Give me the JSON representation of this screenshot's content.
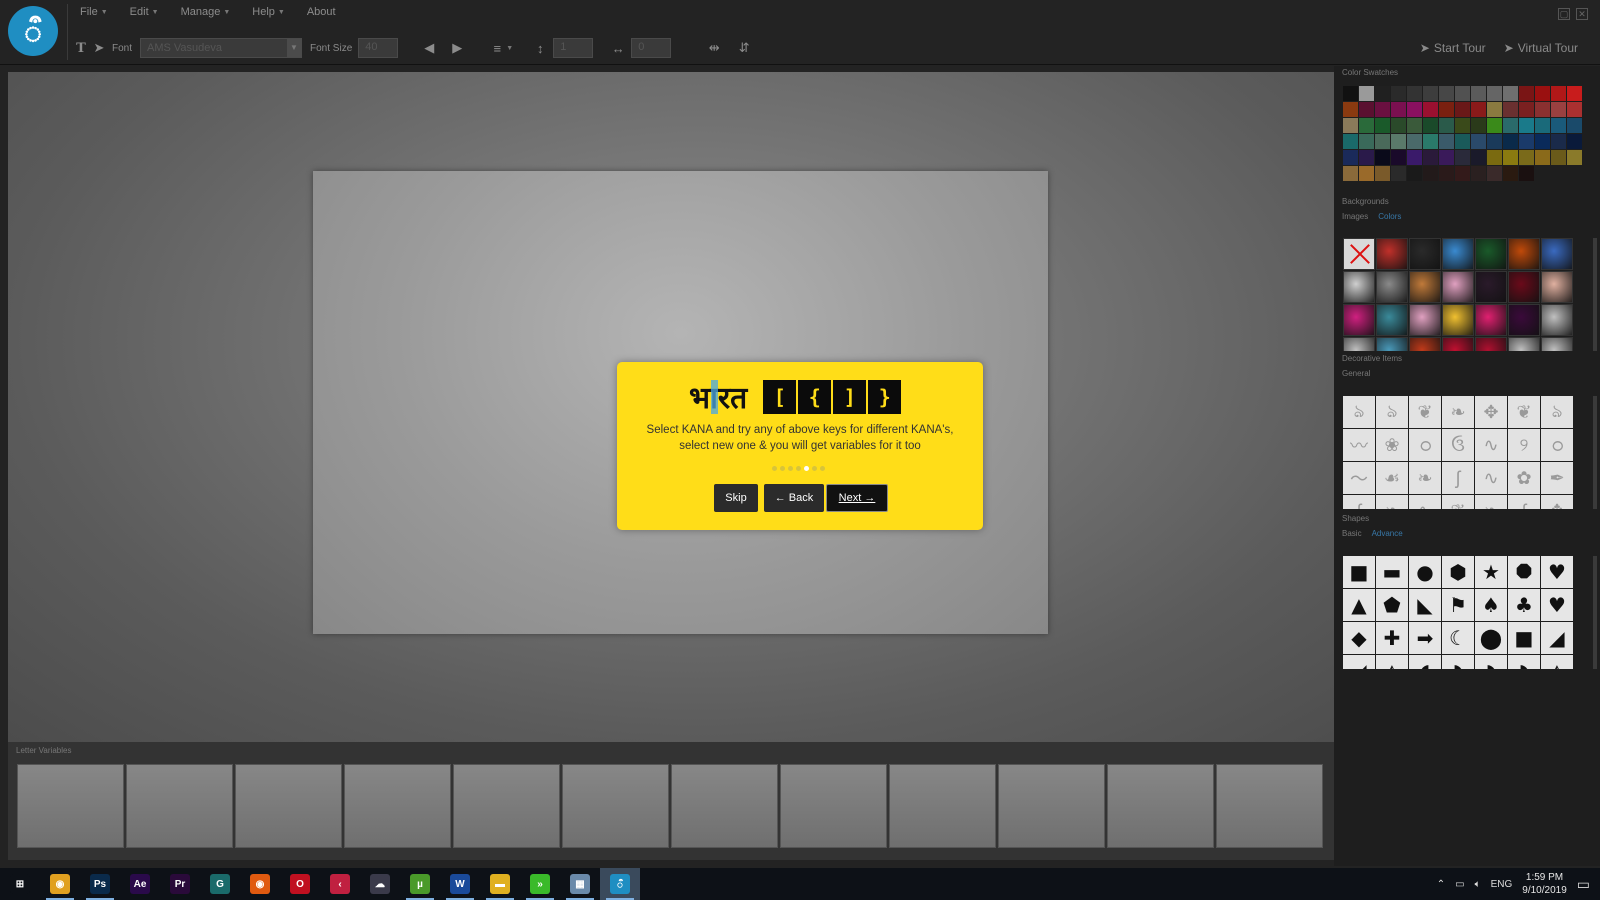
{
  "app": {
    "logo_glyph": "ऀ",
    "menu": [
      {
        "label": "File",
        "has_caret": true
      },
      {
        "label": "Edit",
        "has_caret": true
      },
      {
        "label": "Manage",
        "has_caret": true
      },
      {
        "label": "Help",
        "has_caret": true
      },
      {
        "label": "About",
        "has_caret": false
      }
    ]
  },
  "toolbar": {
    "font_label": "Font",
    "font_value": "AMS Vasudeva",
    "font_size_label": "Font Size",
    "font_size_value": "40",
    "line_height_value": "1",
    "letter_spacing_value": "0",
    "start_tour_label": "Start Tour",
    "virtual_tour_label": "Virtual Tour"
  },
  "tour": {
    "word": "भारत",
    "keys": [
      "[",
      "{",
      "]",
      "}"
    ],
    "text_line1": "Select KANA and try any of above keys for different KANA's,",
    "text_line2": "select new one & you will get variables for it too",
    "steps_total": 7,
    "current_step": 5,
    "skip_label": "Skip",
    "back_label": "← Back",
    "next_label": "Next →"
  },
  "letter_variables": {
    "title": "Letter Variables",
    "cell_count": 12
  },
  "right_panel": {
    "color_swatches_title": "Color Swatches",
    "swatches": [
      "#111111",
      "#9a9a9a",
      "#202020",
      "#2a2a2a",
      "#333333",
      "#3d3d3d",
      "#474747",
      "#515151",
      "#5b5b5b",
      "#656565",
      "#6f6f6f",
      "#7a1515",
      "#9a1010",
      "#b01818",
      "#c81c1c",
      "#8a3a10",
      "#5a1030",
      "#6a1040",
      "#7a1050",
      "#8a1060",
      "#9a1030",
      "#7a2010",
      "#6a1818",
      "#8a1a1a",
      "#8a7a40",
      "#6a3030",
      "#7a2020",
      "#8a3030",
      "#9a4040",
      "#aa3030",
      "#8a7a5a",
      "#2a6a3a",
      "#1a5a2a",
      "#2a4a2a",
      "#3a5a3a",
      "#1a4a2a",
      "#2a5a4a",
      "#3a4a1a",
      "#2a3a1a",
      "#3a8a1a",
      "#2a6a6a",
      "#1a7a8a",
      "#1a6a7a",
      "#1a5a7a",
      "#1a4a6a",
      "#1a6a6a",
      "#3a6a5a",
      "#4a6a5a",
      "#5a7a6a",
      "#4a6a6a",
      "#2a7a6a",
      "#3a5a6a",
      "#1a5a5a",
      "#2a4a6a",
      "#1a3a5a",
      "#0a2a4a",
      "#1a3a6a",
      "#0a2a5a",
      "#1a2a4a",
      "#0a1a3a",
      "#1a2a5a",
      "#2a1a4a",
      "#0a0a1a",
      "#1a0a2a",
      "#3a1a6a",
      "#2a1a3a",
      "#3a1a5a",
      "#2a2a3a",
      "#1a1a2a",
      "#7a6a10",
      "#8a7a10",
      "#7a6a1a",
      "#8a6a1a",
      "#6a5a1a",
      "#8a7a2a",
      "#8a6a3a",
      "#9a6a2a",
      "#7a5a2a",
      "#2a2a2a",
      "#1a1a1a",
      "#221a1a",
      "#2a1a1a",
      "#331a1a",
      "#2a2020",
      "#3a2a2a",
      "#2a1a10",
      "#1a1010"
    ],
    "backgrounds_title": "Backgrounds",
    "backgrounds_tab_images": "Images",
    "backgrounds_tab_colors": "Colors",
    "backgrounds_tab_active": "Colors",
    "bg_thumbs": [
      "none",
      "#c0302a",
      "#2a2a2a",
      "#3a8ad0",
      "#1a5a2a",
      "#c04a0a",
      "#3a6ac0",
      "#cfcfcf",
      "#8a8a8a",
      "#c07a3a",
      "#e0a0c0",
      "#2a1a2a",
      "#6a0a1a",
      "#e0b0a0",
      "#d02080",
      "#3a8a9a",
      "#e0a0c0",
      "#f0c030",
      "#e02070",
      "#3a0a3a",
      "#c0c0c0",
      "#c0c0c0",
      "#4a9aba",
      "#c03a1a",
      "#c01030",
      "#b01030",
      "#c0c0c0",
      "#c0c0c0"
    ],
    "decorative_title": "Decorative Items",
    "decorative_sub": "General",
    "deco_items": [
      "ঌ",
      "ঌ",
      "❦",
      "❧",
      "✥",
      "❦",
      "ঌ",
      "〰",
      "❀",
      "ഠ",
      "ઉ",
      "∿",
      "୨",
      "ഠ",
      "〜",
      "☙",
      "❧",
      "ʃ",
      "∿",
      "✿",
      "✒",
      "ʃ",
      "❧",
      "∿",
      "❦",
      "❧",
      "ʃ",
      "✥"
    ],
    "shapes_title": "Shapes",
    "shapes_tab_basic": "Basic",
    "shapes_tab_advance": "Advance",
    "shapes_tab_active": "Advance",
    "shape_items": [
      "■",
      "▬",
      "●",
      "⬢",
      "★",
      "⯃",
      "♥",
      "▲",
      "⬟",
      "◣",
      "⚑",
      "♠",
      "♣",
      "♥",
      "◆",
      "✚",
      "➡",
      "☾",
      "⬤",
      "■",
      "◢",
      "◢",
      "◭",
      "◖",
      "◗",
      "◗",
      "◗",
      "◭"
    ]
  },
  "taskbar": {
    "apps": [
      {
        "name": "windows-start",
        "label": "⊞",
        "color": "#0d1117",
        "running": false,
        "current": false
      },
      {
        "name": "chrome",
        "label": "◉",
        "color": "#e0a020",
        "running": true,
        "current": false
      },
      {
        "name": "photoshop",
        "label": "Ps",
        "color": "#0a2a4a",
        "running": true,
        "current": false
      },
      {
        "name": "after-effects",
        "label": "Ae",
        "color": "#2a0a4a",
        "running": false,
        "current": false
      },
      {
        "name": "premiere",
        "label": "Pr",
        "color": "#2a0a3a",
        "running": false,
        "current": false
      },
      {
        "name": "app-g",
        "label": "G",
        "color": "#1a6a6a",
        "running": false,
        "current": false
      },
      {
        "name": "firefox",
        "label": "◉",
        "color": "#e05a10",
        "running": false,
        "current": false
      },
      {
        "name": "opera",
        "label": "O",
        "color": "#c01020",
        "running": false,
        "current": false
      },
      {
        "name": "app-arrow",
        "label": "‹",
        "color": "#c02040",
        "running": false,
        "current": false
      },
      {
        "name": "app-cloud",
        "label": "☁",
        "color": "#3a3a4a",
        "running": false,
        "current": false
      },
      {
        "name": "utorrent",
        "label": "µ",
        "color": "#4a9a2a",
        "running": true,
        "current": false
      },
      {
        "name": "word",
        "label": "W",
        "color": "#1a4a9a",
        "running": true,
        "current": false
      },
      {
        "name": "file-explorer",
        "label": "▬",
        "color": "#e0b020",
        "running": true,
        "current": false
      },
      {
        "name": "app-chevrons",
        "label": "»",
        "color": "#3aba2a",
        "running": true,
        "current": false
      },
      {
        "name": "app-image",
        "label": "▦",
        "color": "#6a8aaa",
        "running": true,
        "current": false
      },
      {
        "name": "current-app",
        "label": "ऀ",
        "color": "#1f8ec2",
        "running": true,
        "current": true
      }
    ],
    "tray_language": "ENG",
    "time": "1:59 PM",
    "date": "9/10/2019"
  }
}
